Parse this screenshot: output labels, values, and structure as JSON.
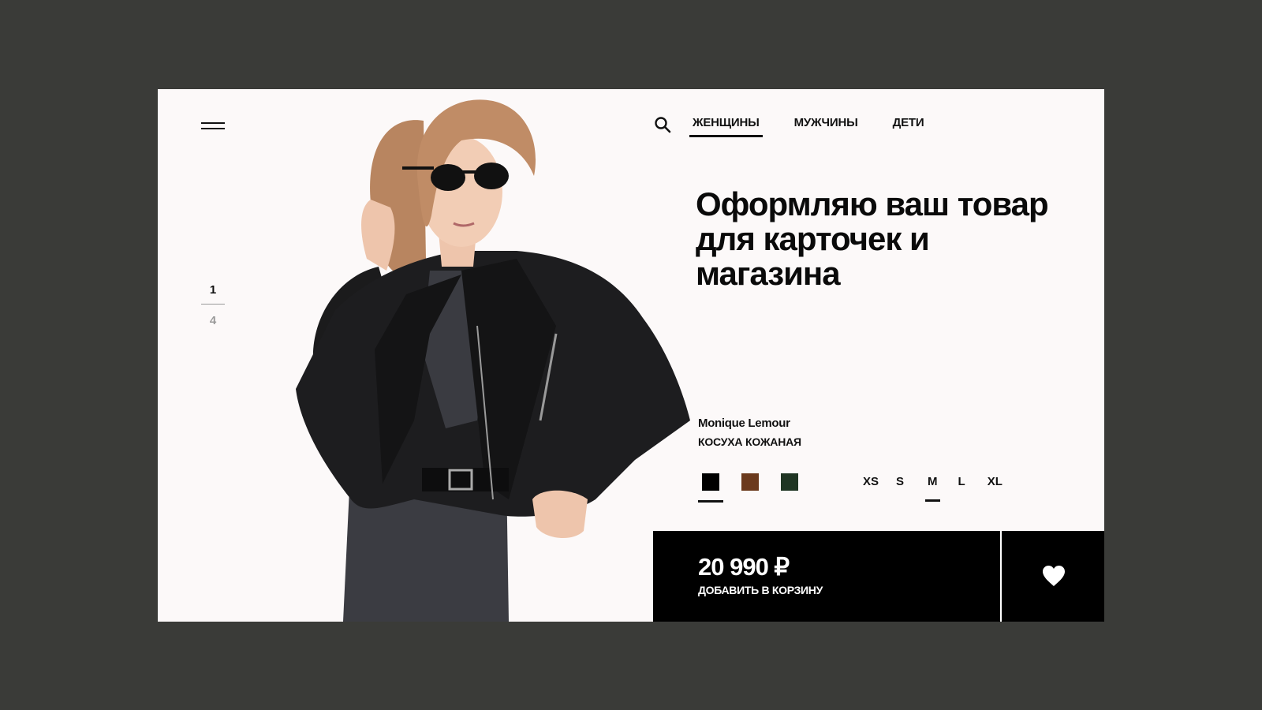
{
  "nav": {
    "items": [
      {
        "label": "ЖЕНЩИНЫ",
        "active": true
      },
      {
        "label": "МУЖЧИНЫ",
        "active": false
      },
      {
        "label": "ДЕТИ",
        "active": false
      }
    ]
  },
  "pager": {
    "current": "1",
    "total": "4"
  },
  "hero": {
    "headline": "Оформляю ваш товар для карточек и магазина"
  },
  "product": {
    "brand": "Monique Lemour",
    "name": "КОСУХА КОЖАНАЯ",
    "colors": [
      {
        "hex": "#000000",
        "selected": true
      },
      {
        "hex": "#6b3a1d",
        "selected": false
      },
      {
        "hex": "#1f3523",
        "selected": false
      }
    ],
    "sizes": [
      {
        "label": "XS",
        "selected": false
      },
      {
        "label": "S",
        "selected": false
      },
      {
        "label": "M",
        "selected": true
      },
      {
        "label": "L",
        "selected": false
      },
      {
        "label": "XL",
        "selected": false
      }
    ],
    "price": "20 990 ₽",
    "add_to_cart": "ДОБАВИТЬ В КОРЗИНУ"
  },
  "icons": {
    "menu": "menu-icon",
    "search": "search-icon",
    "favorite": "heart-icon"
  },
  "colors": {
    "page_bg": "#3a3b38",
    "card_bg": "#fcf9f9",
    "bar_bg": "#000000"
  }
}
